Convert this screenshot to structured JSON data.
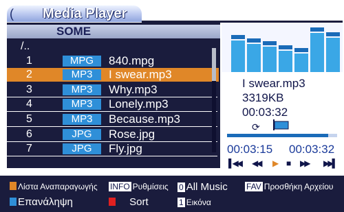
{
  "header": {
    "back_arrow": "(",
    "title": "Media Player"
  },
  "folder": {
    "name": "SOME",
    "parent": "/.."
  },
  "files": [
    {
      "num": "1",
      "type": "MPG",
      "name": "840.mpg",
      "selected": false
    },
    {
      "num": "2",
      "type": "MP3",
      "name": "I swear.mp3",
      "selected": true
    },
    {
      "num": "3",
      "type": "MP3",
      "name": "Why.mp3",
      "selected": false
    },
    {
      "num": "4",
      "type": "MP3",
      "name": "Lonely.mp3",
      "selected": false
    },
    {
      "num": "5",
      "type": "MP3",
      "name": "Because.mp3",
      "selected": false
    },
    {
      "num": "6",
      "type": "JPG",
      "name": "Rose.jpg",
      "selected": false
    },
    {
      "num": "7",
      "type": "JPG",
      "name": "Fly.jpg",
      "selected": false
    }
  ],
  "now_playing": {
    "title": "I swear.mp3",
    "size": "3319KB",
    "duration": "00:03:32",
    "elapsed": "00:03:15",
    "total": "00:03:32",
    "progress_fraction": 0.92,
    "repeat_icon": "repeat-icon",
    "flag_icon": "flag-icon"
  },
  "equalizer_levels": [
    0.8,
    0.72,
    0.66,
    0.58,
    0.52,
    0.96,
    0.86
  ],
  "controls": {
    "first": "▌◀◀",
    "prev": "◀◀",
    "play": "▶",
    "stop": "■",
    "next": "▶▶",
    "last": "▶▶▌"
  },
  "help": {
    "playlist_label": "Λίστα Αναπαραγωγής",
    "info_key": "INFO",
    "info_label": "Ρυθμίσεις",
    "zero_key": "0",
    "zero_label": "All Music",
    "fav_key": "FAV",
    "fav_label": "Προσθήκη Αρχείου",
    "repeat_label": "Επανάληψη",
    "sort_label": "Sort",
    "one_key": "1",
    "one_label": "Εικόνα"
  },
  "colors": {
    "panel": "#1a1c3d",
    "selected": "#e08728",
    "badge": "#2f8fd8",
    "orange_key": "#e08728",
    "blue_key": "#2f8fd8",
    "red_key": "#e02020"
  }
}
